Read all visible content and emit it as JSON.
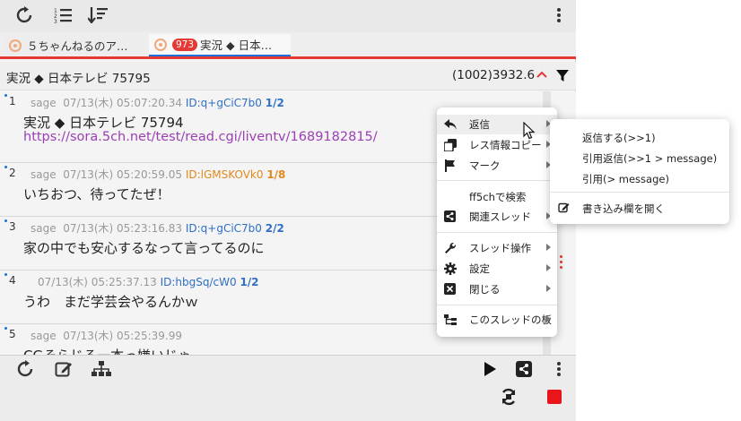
{
  "toolbar": {
    "icons": [
      "refresh-icon",
      "numbered-list-icon",
      "sort-descending-icon",
      "more-vertical-icon"
    ]
  },
  "tabs": [
    {
      "label": "５ちゃんねるのア…",
      "icon": "board-icon"
    },
    {
      "badge": "973",
      "label": "実況 ◆ 日本…",
      "icon": "board-icon",
      "active": true
    }
  ],
  "thread": {
    "title": "実況 ◆ 日本テレビ 75795",
    "count": "(1002)3932.6"
  },
  "posts": [
    {
      "num": "1",
      "name": "sage",
      "date": "07/13(木) 05:07:20.34",
      "id": "ID:q+gCiC7b0",
      "count": "1/2",
      "id_color": "blue",
      "body": "実況 ◆ 日本テレビ 75794",
      "link": "https://sora.5ch.net/test/read.cgi/liventv/1689182815/"
    },
    {
      "num": "2",
      "name": "sage",
      "date": "07/13(木) 05:20:59.05",
      "id": "ID:lGMSKOVk0",
      "count": "1/8",
      "id_color": "orange",
      "body": "いちおつ、待ってたぜ！"
    },
    {
      "num": "3",
      "name": "sage",
      "date": "07/13(木) 05:23:16.83",
      "id": "ID:q+gCiC7b0",
      "count": "2/2",
      "id_color": "blue",
      "body": "家の中でも安心するなって言ってるのに"
    },
    {
      "num": "4",
      "name": "",
      "date": "07/13(木) 05:25:37.13",
      "id": "ID:hbgSq/cW0",
      "count": "1/2",
      "id_color": "blue",
      "body": "うわ　まだ学芸会やるんかｗ"
    },
    {
      "num": "5",
      "name": "sage",
      "date": "07/13(木) 05:25:39.99",
      "id": "",
      "count": "",
      "id_color": "blue",
      "body": "CGそらじる一本っ嫌いじゃ"
    }
  ],
  "context_menu": {
    "items": [
      {
        "label": "返信",
        "icon": "reply-icon",
        "submenu": true
      },
      {
        "label": "レス情報コピー",
        "icon": "copy-icon",
        "submenu": true
      },
      {
        "label": "マーク",
        "icon": "flag-icon",
        "submenu": true
      },
      {
        "label": "ff5chで検索",
        "icon": "",
        "submenu": false
      },
      {
        "label": "関連スレッド",
        "icon": "share-icon",
        "submenu": true
      },
      {
        "label": "スレッド操作",
        "icon": "wrench-icon",
        "submenu": true
      },
      {
        "label": "設定",
        "icon": "gear-icon",
        "submenu": true
      },
      {
        "label": "閉じる",
        "icon": "close-box-icon",
        "submenu": true
      },
      {
        "label": "このスレッドの板",
        "icon": "tree-icon",
        "submenu": true
      }
    ]
  },
  "submenu": {
    "items": [
      {
        "label": "返信する(>>1)"
      },
      {
        "label": "引用返信(>>1 > message)"
      },
      {
        "label": "引用(> message)"
      },
      {
        "label": "書き込み欄を開く",
        "icon": "edit-icon"
      }
    ]
  },
  "bottom": {
    "icons": [
      "refresh-icon",
      "edit-icon",
      "sitemap-icon",
      "play-icon",
      "share-icon",
      "more-vertical-icon",
      "auto-refresh-icon",
      "stop-icon"
    ]
  },
  "colors": {
    "accent_red": "#e53935",
    "link_purple": "#9b3fb3",
    "id_blue": "#2f6fc6",
    "id_orange": "#e08a1e"
  }
}
